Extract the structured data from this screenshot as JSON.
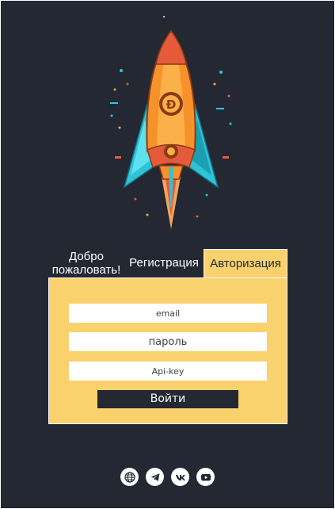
{
  "app": {
    "logo": "rocket-bitcoin-logo"
  },
  "tabs": {
    "welcome": "Добро пожаловать!",
    "register": "Регистрация",
    "auth": "Авторизация",
    "active": "auth"
  },
  "form": {
    "email_placeholder": "email",
    "password_placeholder": "пароль",
    "apikey_placeholder": "Api-key",
    "submit_label": "Войти"
  },
  "social": [
    {
      "icon": "globe-icon"
    },
    {
      "icon": "telegram-icon"
    },
    {
      "icon": "vk-icon"
    },
    {
      "icon": "youtube-icon"
    }
  ],
  "colors": {
    "background": "#232832",
    "accent": "#f9d26d",
    "field": "#ffffff",
    "button": "#232832"
  }
}
